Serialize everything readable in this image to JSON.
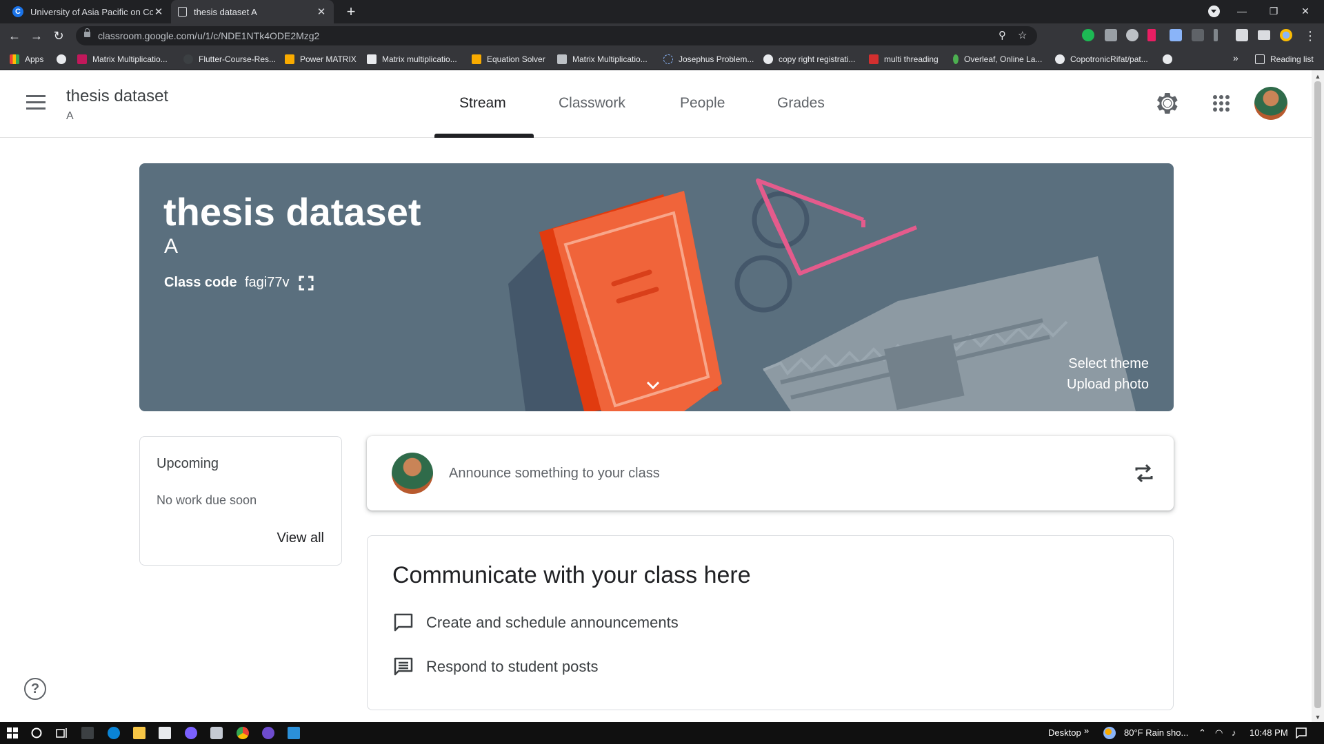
{
  "browser": {
    "tabs": [
      {
        "title": "University of Asia Pacific on Cour",
        "active": false
      },
      {
        "title": "thesis dataset A",
        "active": true
      }
    ],
    "url": "classroom.google.com/u/1/c/NDE1NTk4ODE2Mzg2",
    "bookmarks": [
      "Apps",
      "Matrix Multiplicatio...",
      "Flutter-Course-Res...",
      "Power MATRIX",
      "Matrix multiplicatio...",
      "Equation Solver",
      "Matrix Multiplicatio...",
      "Josephus Problem...",
      "copy right registrati...",
      "multi threading",
      "Overleaf, Online La...",
      "CopotronicRifat/pat..."
    ],
    "reading_list": "Reading list",
    "more_bookmarks": "»"
  },
  "header": {
    "class_name": "thesis dataset",
    "section": "A",
    "tabs": [
      "Stream",
      "Classwork",
      "People",
      "Grades"
    ],
    "active_tab": "Stream"
  },
  "banner": {
    "title": "thesis dataset",
    "section": "A",
    "class_code_label": "Class code",
    "class_code": "fagi77v",
    "select_theme": "Select theme",
    "upload_photo": "Upload photo",
    "color": "#5a6f7e"
  },
  "upcoming": {
    "title": "Upcoming",
    "empty": "No work due soon",
    "view_all": "View all"
  },
  "announce": {
    "placeholder": "Announce something to your class"
  },
  "communicate": {
    "title": "Communicate with your class here",
    "items": [
      "Create and schedule announcements",
      "Respond to student posts"
    ]
  },
  "help": {
    "glyph": "?"
  },
  "taskbar": {
    "desktop": "Desktop",
    "chevron": "»",
    "weather": "80°F  Rain sho...",
    "time": "10:48 PM"
  }
}
